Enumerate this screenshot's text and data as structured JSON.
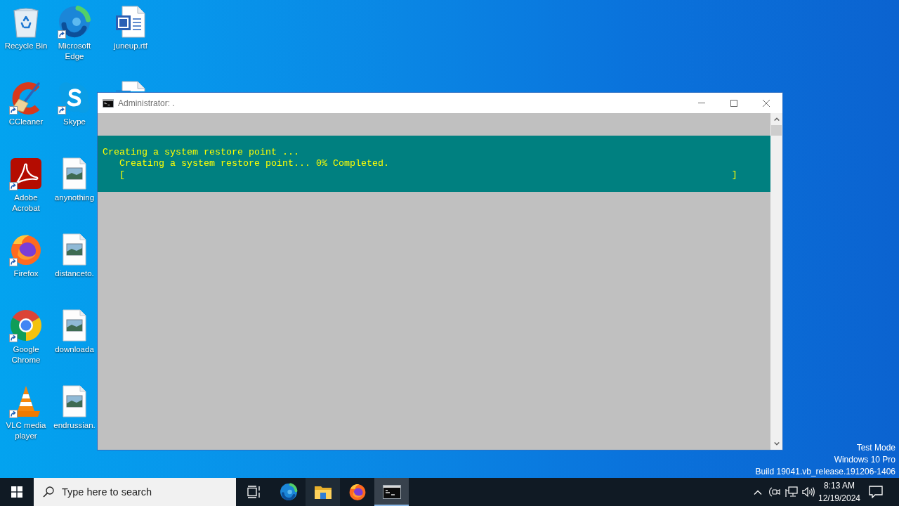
{
  "desktop": {
    "columns": [
      {
        "icons": [
          {
            "kind": "recycle",
            "label": "Recycle Bin",
            "shortcut": false
          },
          {
            "kind": "ccleaner",
            "label": "CCleaner",
            "shortcut": true
          },
          {
            "kind": "acrobat",
            "label": "Adobe Acrobat",
            "shortcut": true
          },
          {
            "kind": "firefox",
            "label": "Firefox",
            "shortcut": true
          },
          {
            "kind": "chrome",
            "label": "Google Chrome",
            "shortcut": true
          },
          {
            "kind": "vlc",
            "label": "VLC media player",
            "shortcut": true
          }
        ]
      },
      {
        "icons": [
          {
            "kind": "edge",
            "label": "Microsoft Edge",
            "shortcut": true
          },
          {
            "kind": "skype",
            "label": "Skype",
            "shortcut": true
          },
          {
            "kind": "image",
            "label": "anynothing",
            "shortcut": false
          },
          {
            "kind": "image",
            "label": "distanceto.",
            "shortcut": false
          },
          {
            "kind": "image",
            "label": "downloada",
            "shortcut": false
          },
          {
            "kind": "image",
            "label": "endrussian.",
            "shortcut": false
          }
        ]
      },
      {
        "icons": [
          {
            "kind": "document",
            "label": "juneup.rtf",
            "shortcut": false
          },
          {
            "kind": "document",
            "shortcut": false,
            "partly_hidden": true
          }
        ]
      }
    ],
    "system_notice": [
      "Test Mode",
      "Windows 10 Pro",
      "Build 19041.vb_release.191206-1406"
    ]
  },
  "console_window": {
    "title": "Administrator: .",
    "progress_panel": {
      "activity": "Creating a system restore point ...",
      "status": "Creating a system restore point... 0% Completed.",
      "progress": {
        "left": "[",
        "right": "]"
      }
    }
  },
  "taskbar": {
    "search": {
      "placeholder": "Type here to search"
    },
    "apps": [
      {
        "kind": "edge",
        "highlighted": false,
        "active": false
      },
      {
        "kind": "explorer",
        "highlighted": true,
        "active": false
      },
      {
        "kind": "firefox",
        "highlighted": false,
        "active": false
      },
      {
        "kind": "console",
        "highlighted": true,
        "active": true
      }
    ],
    "tray": {
      "time": "8:13 AM",
      "date": "12/19/2024"
    }
  }
}
